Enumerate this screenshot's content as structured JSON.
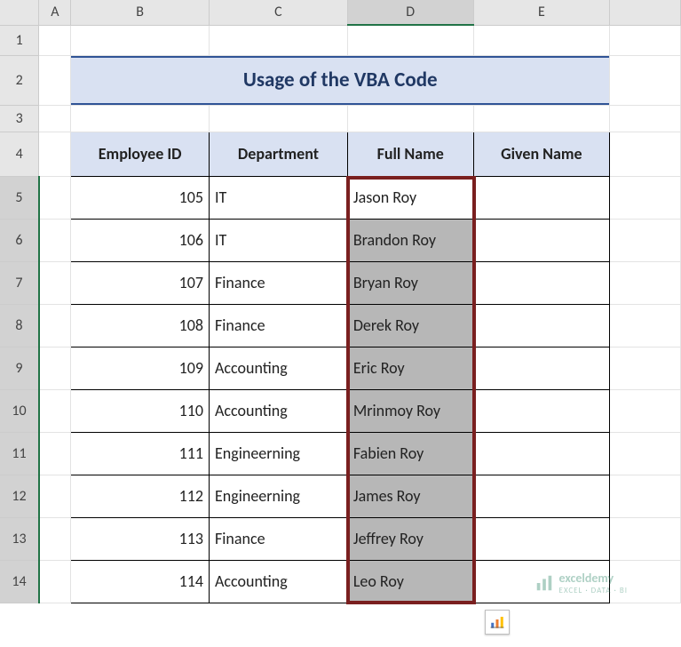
{
  "columns": [
    "A",
    "B",
    "C",
    "D",
    "E"
  ],
  "rows": [
    "1",
    "2",
    "3",
    "4",
    "5",
    "6",
    "7",
    "8",
    "9",
    "10",
    "11",
    "12",
    "13",
    "14"
  ],
  "title": "Usage of the VBA Code",
  "headers": {
    "empid": "Employee ID",
    "dept": "Department",
    "fullname": "Full Name",
    "given": "Given Name"
  },
  "data": [
    {
      "id": "105",
      "dept": "IT",
      "name": "Jason Roy"
    },
    {
      "id": "106",
      "dept": "IT",
      "name": "Brandon Roy"
    },
    {
      "id": "107",
      "dept": "Finance",
      "name": "Bryan Roy"
    },
    {
      "id": "108",
      "dept": "Finance",
      "name": "Derek Roy"
    },
    {
      "id": "109",
      "dept": "Accounting",
      "name": "Eric Roy"
    },
    {
      "id": "110",
      "dept": "Accounting",
      "name": "Mrinmoy Roy"
    },
    {
      "id": "111",
      "dept": "Engineerning",
      "name": "Fabien Roy"
    },
    {
      "id": "112",
      "dept": "Engineerning",
      "name": "James Roy"
    },
    {
      "id": "113",
      "dept": "Finance",
      "name": "Jeffrey Roy"
    },
    {
      "id": "114",
      "dept": "Accounting",
      "name": "Leo Roy"
    }
  ],
  "watermark": {
    "brand": "exceldemy",
    "sub": "EXCEL · DATA · BI"
  },
  "colwidths": {
    "A": 36,
    "B": 156,
    "C": 156,
    "D": 142,
    "E": 154
  },
  "selection": {
    "col": "D",
    "rows": [
      5,
      14
    ]
  }
}
